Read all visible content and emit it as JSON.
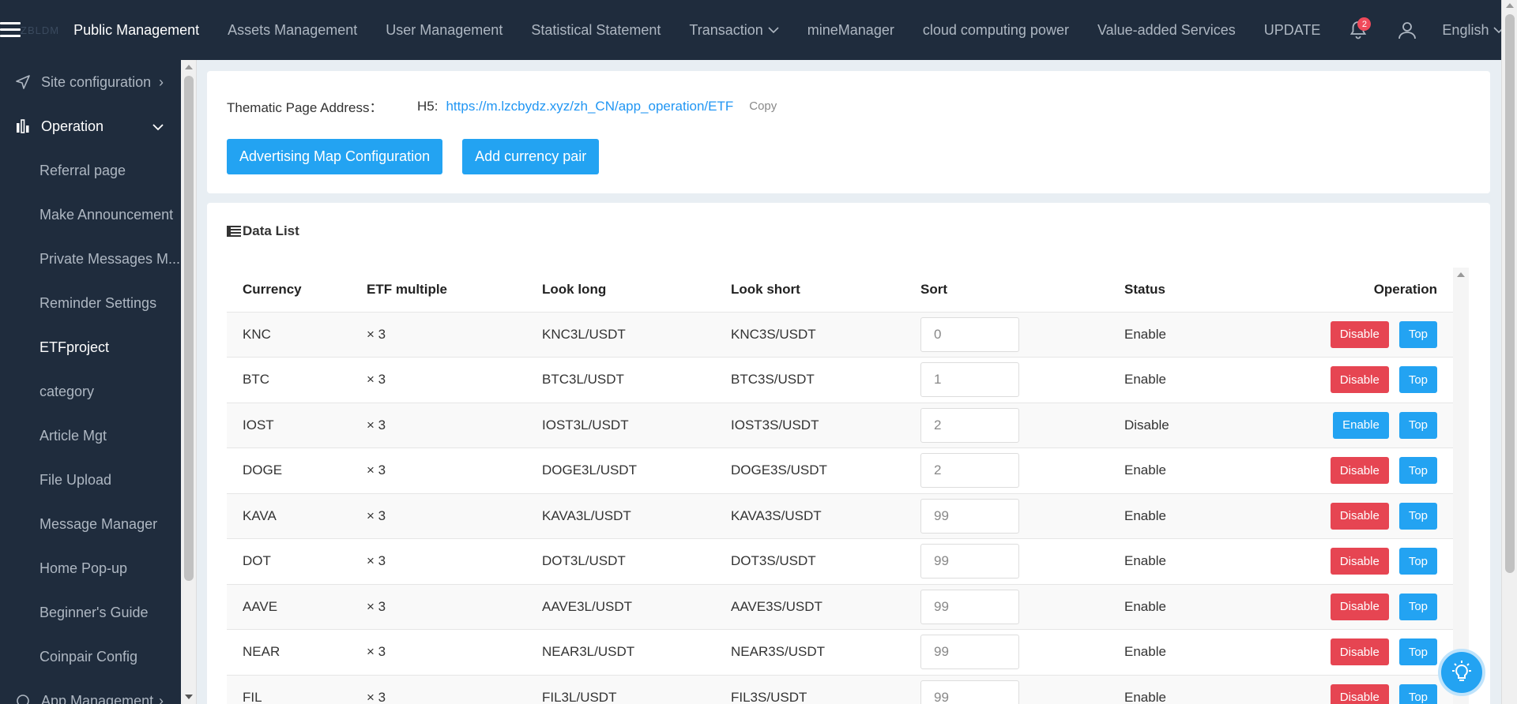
{
  "topbar": {
    "logo": "ZBLDM",
    "nav": [
      {
        "label": "Public Management",
        "active": true,
        "dropdown": false
      },
      {
        "label": "Assets Management",
        "active": false,
        "dropdown": false
      },
      {
        "label": "User Management",
        "active": false,
        "dropdown": false
      },
      {
        "label": "Statistical Statement",
        "active": false,
        "dropdown": false
      },
      {
        "label": "Transaction",
        "active": false,
        "dropdown": true
      },
      {
        "label": "mineManager",
        "active": false,
        "dropdown": false
      },
      {
        "label": "cloud computing power",
        "active": false,
        "dropdown": false
      },
      {
        "label": "Value-added Services",
        "active": false,
        "dropdown": false
      }
    ],
    "update": "UPDATE",
    "notification_count": "2",
    "language": "English"
  },
  "sidebar": {
    "site_config": "Site configuration",
    "operation": "Operation",
    "items": [
      "Referral page",
      "Make Announcement",
      "Private Messages M...",
      "Reminder Settings",
      "ETFproject",
      "category",
      "Article Mgt",
      "File Upload",
      "Message Manager",
      "Home Pop-up",
      "Beginner's Guide",
      "Coinpair Config"
    ],
    "current": "ETFproject",
    "app_management": "App Management"
  },
  "top_card": {
    "address_label": "Thematic Page Address：",
    "h5_label": "H5:",
    "address_url": "https://m.lzcbydz.xyz/zh_CN/app_operation/ETF",
    "copy": "Copy",
    "btn_advertising": "Advertising Map Configuration",
    "btn_add_pair": "Add currency pair"
  },
  "list": {
    "title": "Data List",
    "headers": [
      "Currency",
      "ETF multiple",
      "Look long",
      "Look short",
      "Sort",
      "Status",
      "Operation"
    ],
    "rows": [
      {
        "currency": "KNC",
        "multiple": "× 3",
        "long": "KNC3L/USDT",
        "short": "KNC3S/USDT",
        "sort": "0",
        "status": "Enable",
        "action": "Disable",
        "top": "Top"
      },
      {
        "currency": "BTC",
        "multiple": "× 3",
        "long": "BTC3L/USDT",
        "short": "BTC3S/USDT",
        "sort": "1",
        "status": "Enable",
        "action": "Disable",
        "top": "Top"
      },
      {
        "currency": "IOST",
        "multiple": "× 3",
        "long": "IOST3L/USDT",
        "short": "IOST3S/USDT",
        "sort": "2",
        "status": "Disable",
        "action": "Enable",
        "top": "Top"
      },
      {
        "currency": "DOGE",
        "multiple": "× 3",
        "long": "DOGE3L/USDT",
        "short": "DOGE3S/USDT",
        "sort": "2",
        "status": "Enable",
        "action": "Disable",
        "top": "Top"
      },
      {
        "currency": "KAVA",
        "multiple": "× 3",
        "long": "KAVA3L/USDT",
        "short": "KAVA3S/USDT",
        "sort": "99",
        "status": "Enable",
        "action": "Disable",
        "top": "Top"
      },
      {
        "currency": "DOT",
        "multiple": "× 3",
        "long": "DOT3L/USDT",
        "short": "DOT3S/USDT",
        "sort": "99",
        "status": "Enable",
        "action": "Disable",
        "top": "Top"
      },
      {
        "currency": "AAVE",
        "multiple": "× 3",
        "long": "AAVE3L/USDT",
        "short": "AAVE3S/USDT",
        "sort": "99",
        "status": "Enable",
        "action": "Disable",
        "top": "Top"
      },
      {
        "currency": "NEAR",
        "multiple": "× 3",
        "long": "NEAR3L/USDT",
        "short": "NEAR3S/USDT",
        "sort": "99",
        "status": "Enable",
        "action": "Disable",
        "top": "Top"
      },
      {
        "currency": "FIL",
        "multiple": "× 3",
        "long": "FIL3L/USDT",
        "short": "FIL3S/USDT",
        "sort": "99",
        "status": "Enable",
        "action": "Disable",
        "top": "Top"
      }
    ]
  },
  "colors": {
    "nav_bg": "#1f2c3d",
    "accent_blue": "#23a3f2",
    "danger_red": "#e64552",
    "link_blue": "#2196f3"
  }
}
